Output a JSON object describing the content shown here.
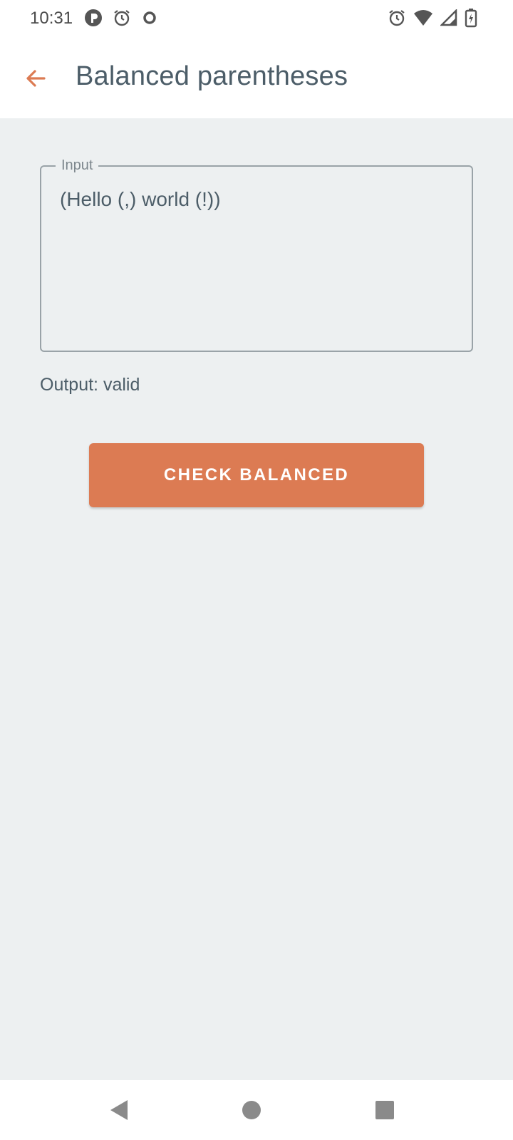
{
  "status_bar": {
    "time": "10:31",
    "left_icons": [
      "app-notification-icon",
      "alarm-icon",
      "circle-icon"
    ],
    "right_icons": [
      "alarm-icon",
      "wifi-icon",
      "signal-icon",
      "battery-charging-icon"
    ]
  },
  "app_bar": {
    "title": "Balanced parentheses",
    "back_icon": "arrow-back-icon"
  },
  "form": {
    "input_label": "Input",
    "input_value": "(Hello (,) world (!))",
    "output": "Output: valid",
    "button_label": "CHECK BALANCED"
  },
  "nav_bar": {
    "buttons": [
      "back-triangle-icon",
      "home-circle-icon",
      "recents-square-icon"
    ]
  },
  "colors": {
    "accent": "#dc7b53",
    "text": "#4c5d68",
    "background": "#edf0f1"
  }
}
